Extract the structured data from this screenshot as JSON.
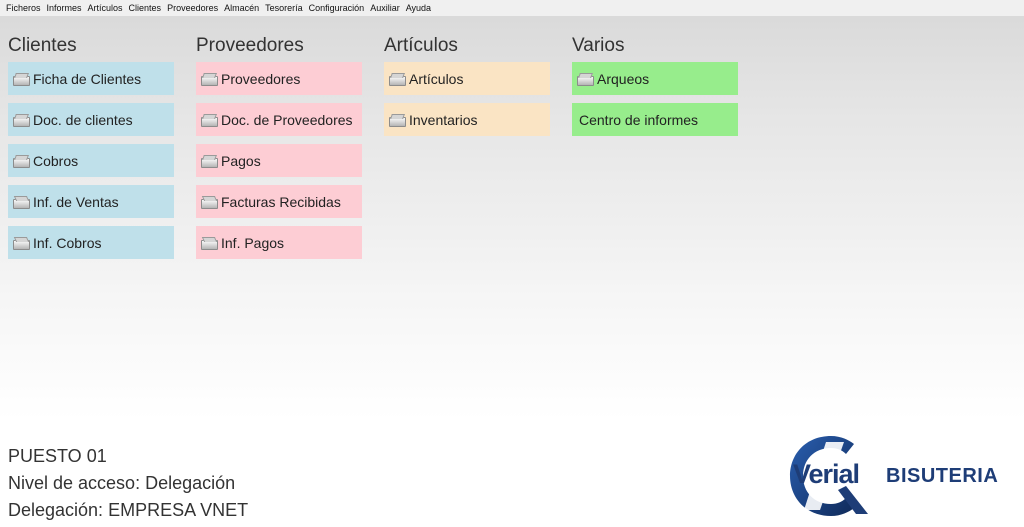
{
  "menubar": {
    "items": [
      "Ficheros",
      "Informes",
      "Artículos",
      "Clientes",
      "Proveedores",
      "Almacén",
      "Tesorería",
      "Configuración",
      "Auxiliar",
      "Ayuda"
    ]
  },
  "clientes": {
    "title": "Clientes",
    "tiles": [
      "Ficha de Clientes",
      "Doc. de clientes",
      "Cobros",
      "Inf. de Ventas",
      "Inf. Cobros"
    ]
  },
  "proveedores": {
    "title": "Proveedores",
    "tiles": [
      "Proveedores",
      "Doc. de Proveedores",
      "Pagos",
      "Facturas Recibidas",
      "Inf. Pagos"
    ]
  },
  "articulos": {
    "title": "Artículos",
    "tiles": [
      "Artículos",
      "Inventarios"
    ]
  },
  "varios": {
    "title": "Varios",
    "tiles": [
      "Arqueos",
      "Centro de informes"
    ]
  },
  "footer": {
    "puesto": "PUESTO 01",
    "nivel": "Nivel de acceso: Delegación",
    "delegacion": "Delegación: EMPRESA VNET"
  },
  "logo": {
    "word": "Verial",
    "brand": "BISUTERIA"
  },
  "colors": {
    "clientes_tile": "#bfe0ea",
    "proveedores_tile": "#fdcdd4",
    "articulos_tile": "#fae4c4",
    "varios_tile": "#97ed8c",
    "brand_blue": "#1e3d77"
  },
  "icons": {
    "tile_icon": "printer-icon"
  }
}
